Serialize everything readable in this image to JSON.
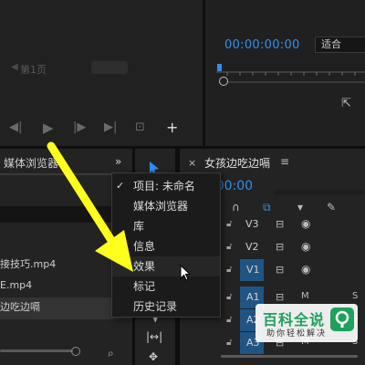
{
  "source_monitor": {
    "page_label": "第1页"
  },
  "program_monitor": {
    "timecode": "00:00:00:00",
    "fit_value": "适合"
  },
  "media_panel": {
    "title": "媒体浏览器",
    "more": "»",
    "files": [
      {
        "name": "接技巧.mp4",
        "selected": false
      },
      {
        "name": "E.mp4",
        "selected": false
      },
      {
        "name": "边吃边嗝",
        "selected": true
      }
    ]
  },
  "timeline": {
    "close": "×",
    "title": "女孩边吃边嗝",
    "menu": "≡",
    "timecode": ":00:00",
    "tracks": [
      {
        "label": "V3",
        "kind": "video",
        "targeted": false
      },
      {
        "label": "V2",
        "kind": "video",
        "targeted": false
      },
      {
        "label": "V1",
        "kind": "video",
        "targeted": true
      },
      {
        "label": "A1",
        "kind": "audio",
        "targeted": true
      },
      {
        "label": "A2",
        "kind": "audio",
        "targeted": true
      },
      {
        "label": "A3",
        "kind": "audio",
        "targeted": true
      }
    ],
    "audio_m": "M",
    "audio_s": "S"
  },
  "menu": {
    "items": [
      {
        "label": "项目: 未命名",
        "checked": true
      },
      {
        "label": "媒体浏览器",
        "checked": false
      },
      {
        "label": "库",
        "checked": false
      },
      {
        "label": "信息",
        "checked": false
      },
      {
        "label": "效果",
        "checked": false
      },
      {
        "label": "标记",
        "checked": false
      },
      {
        "label": "历史记录",
        "checked": false
      }
    ]
  },
  "watermark": {
    "title": "百科全说",
    "subtitle": "助你轻松解决"
  },
  "colors": {
    "accent": "#2f8ef0",
    "annotation": "#ffff1e",
    "target_track": "#205583"
  }
}
